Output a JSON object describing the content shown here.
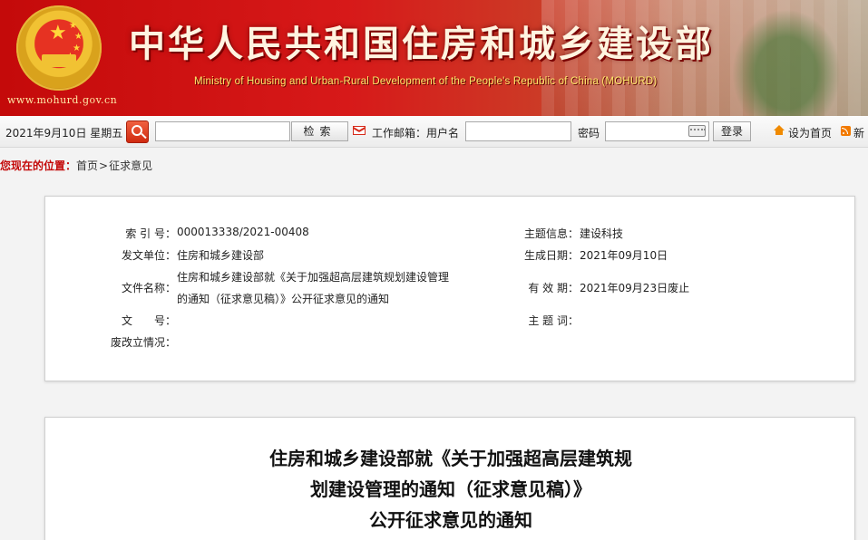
{
  "colors": {
    "brand_red": "#c40a0a",
    "banner_subtitle": "#ffe96a",
    "title_text": "#fff4e0"
  },
  "banner": {
    "url": "www.mohurd.gov.cn",
    "title": "中华人民共和国住房和城乡建设部",
    "subtitle": "Ministry of Housing and Urban-Rural Development of the People's Republic of China (MOHURD)",
    "emblem_icon": "national-emblem"
  },
  "toolbar": {
    "date": "2021年9月10日 星期五",
    "search_icon": "search-icon",
    "search_placeholder": "",
    "search_button": "检索",
    "mail_icon": "mail-icon",
    "mail_label": "工作邮箱：用户名",
    "password_label": "密码",
    "keyboard_icon": "keyboard-icon",
    "login_button": "登录",
    "home_icon": "home-icon",
    "home_link": "设为首页",
    "rss_icon": "rss-icon",
    "rss_link": "新"
  },
  "breadcrumb": {
    "label": "您现在的位置：",
    "items": [
      "首页",
      "征求意见"
    ],
    "separator": ">"
  },
  "info": {
    "index_no": {
      "label": "索 引 号：",
      "value": "000013338/2021-00408"
    },
    "topic": {
      "label": "主题信息：",
      "value": "建设科技"
    },
    "issuer": {
      "label": "发文单位：",
      "value": "住房和城乡建设部"
    },
    "created": {
      "label": "生成日期：",
      "value": "2021年09月10日"
    },
    "doc_name": {
      "label": "文件名称：",
      "value_line1": "住房和城乡建设部就《关于加强超高层建筑规划建设管理",
      "value_line2": "的通知（征求意见稿）》公开征求意见的通知"
    },
    "validity": {
      "label": "有 效 期：",
      "value": "2021年09月23日废止"
    },
    "doc_no": {
      "label": "文　　号：",
      "value": ""
    },
    "keywords": {
      "label": "主 题 词：",
      "value": ""
    },
    "status": {
      "label": "废改立情况：",
      "value": ""
    }
  },
  "article": {
    "title_lines": [
      "住房和城乡建设部就《关于加强超高层建筑规",
      "划建设管理的通知（征求意见稿）》",
      "公开征求意见的通知"
    ]
  }
}
